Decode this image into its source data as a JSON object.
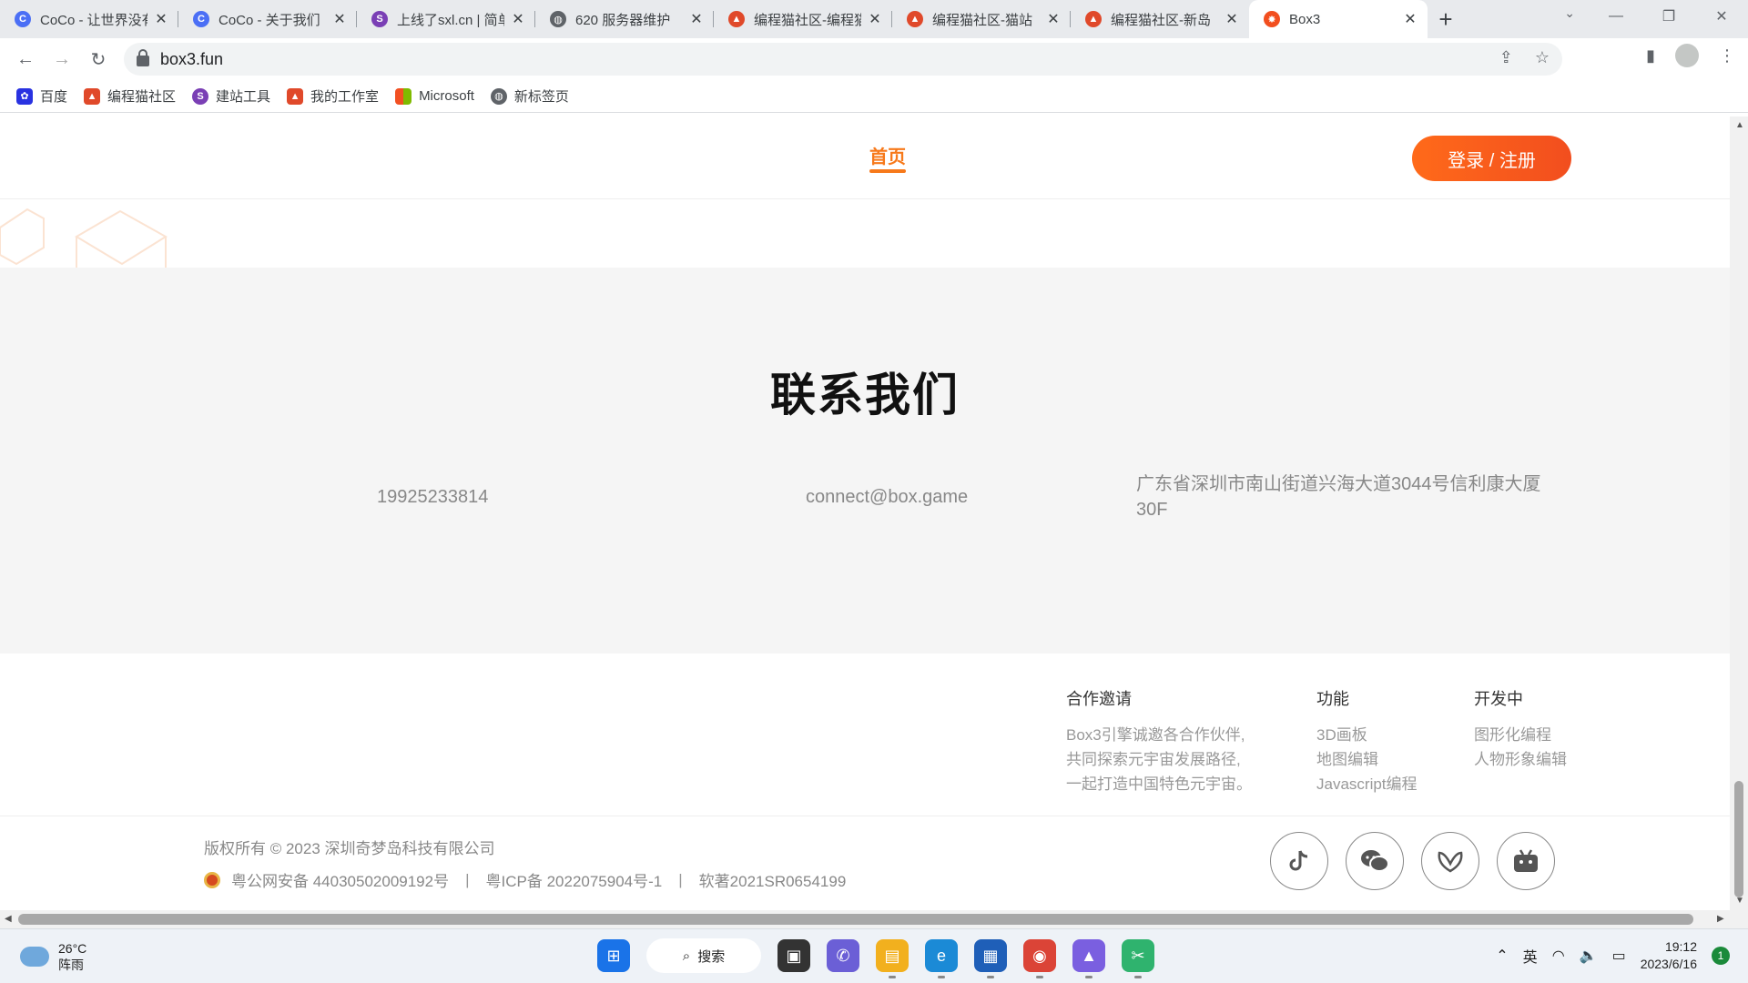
{
  "browser": {
    "tabs": [
      {
        "title": "CoCo - 让世界没有难做的应用",
        "icon": "coco-icon",
        "color": "#4b6ff5"
      },
      {
        "title": "CoCo - 关于我们",
        "icon": "coco-icon",
        "color": "#4b6ff5"
      },
      {
        "title": "上线了sxl.cn | 简单",
        "icon": "strikingly-icon",
        "color": "#7a3fb5"
      },
      {
        "title": "620 服务器维护",
        "icon": "globe-icon",
        "color": "#5f6368"
      },
      {
        "title": "编程猫社区-编程猫",
        "icon": "codemao-icon",
        "color": "#e0492a"
      },
      {
        "title": "编程猫社区-猫站",
        "icon": "codemao-icon",
        "color": "#e0492a"
      },
      {
        "title": "编程猫社区-新岛",
        "icon": "codemao-icon",
        "color": "#e0492a"
      },
      {
        "title": "Box3",
        "icon": "box3-icon",
        "color": "#f24e1e",
        "active": true
      }
    ],
    "url": "box3.fun",
    "bookmarks": [
      {
        "label": "百度",
        "icon": "baidu-icon",
        "color": "#2932e1"
      },
      {
        "label": "编程猫社区",
        "icon": "codemao-icon",
        "color": "#e0492a"
      },
      {
        "label": "建站工具",
        "icon": "strikingly-icon",
        "color": "#7a3fb5"
      },
      {
        "label": "我的工作室",
        "icon": "codemao-icon",
        "color": "#e0492a"
      },
      {
        "label": "Microsoft",
        "icon": "microsoft-icon",
        "color": "#f25022"
      },
      {
        "label": "新标签页",
        "icon": "globe-icon",
        "color": "#5f6368"
      }
    ]
  },
  "site": {
    "nav_home": "首页",
    "login_label": "登录 / 注册",
    "accent_color": "#f7791a",
    "contact": {
      "title": "联系我们",
      "phone": "19925233814",
      "email": "connect@box.game",
      "address_line1": "广东省深圳市南山街道兴海大道3044号信利康大厦",
      "address_line2": "30F"
    },
    "footer": {
      "columns": [
        {
          "heading": "合作邀请",
          "lines": [
            "Box3引擎诚邀各合作伙伴,",
            "共同探索元宇宙发展路径,",
            "一起打造中国特色元宇宙。"
          ]
        },
        {
          "heading": "功能",
          "lines": [
            "3D画板",
            "地图编辑",
            "Javascript编程"
          ]
        },
        {
          "heading": "开发中",
          "lines": [
            "图形化编程",
            "人物形象编辑"
          ]
        }
      ],
      "copyright": "版权所有 © 2023 深圳奇梦岛科技有限公司",
      "police_record": "粤公网安备 44030502009192号",
      "icp": "粤ICP备 2022075904号-1",
      "software": "软著2021SR0654199",
      "social_icons": [
        "douyin-icon",
        "wechat-icon",
        "weibo-icon",
        "bilibili-icon"
      ]
    }
  },
  "taskbar": {
    "temperature": "26°C",
    "weather": "阵雨",
    "search_label": "搜索",
    "ime": "英",
    "time": "19:12",
    "date": "2023/6/16",
    "notifications": "1"
  }
}
